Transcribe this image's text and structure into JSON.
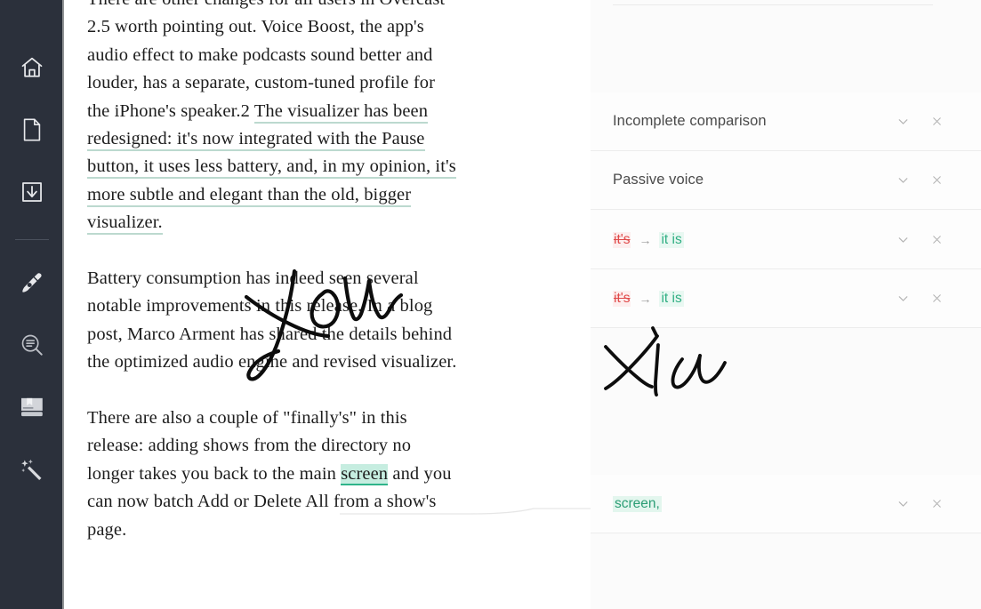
{
  "sidebar": {
    "items": [
      {
        "name": "home",
        "icon": "home-icon"
      },
      {
        "name": "document",
        "icon": "document-icon"
      },
      {
        "name": "import",
        "icon": "import-download-icon"
      },
      {
        "name": "write",
        "icon": "pen-nib-icon"
      },
      {
        "name": "plagiarism",
        "icon": "magnifier-text-icon"
      },
      {
        "name": "dictionary",
        "icon": "book-bookmark-icon"
      },
      {
        "name": "assistant",
        "icon": "magic-wand-icon"
      }
    ]
  },
  "document": {
    "paragraphs": [
      {
        "id": "p1",
        "plain_before": "There are other changes for all users in Overcast 2.5 worth pointing out. Voice Boost, the app's audio effect to make podcasts sound better and louder, has a separate, custom-tuned profile for the iPhone's speaker.2 ",
        "underlined": "The visualizer has been redesigned: it's now integrated with the Pause button, it uses less battery, and, in my opinion, it's more subtle and elegant than the old, bigger visualizer."
      },
      {
        "id": "p2",
        "text": "Battery consumption has indeed seen several notable improvements in this release. In a blog post, Marco Arment has shared the details behind the optimized audio engine and revised visualizer."
      },
      {
        "id": "p3",
        "before": "There are also a couple of \"finally's\" in this release: adding shows from the directory no longer takes you back to the main ",
        "highlight": "screen",
        "after": " and you can now batch Add or Delete All from a show's page."
      }
    ]
  },
  "suggestions": {
    "cards": [
      {
        "type": "label",
        "label": "Incomplete comparison",
        "expand_icon": "chevron-down-icon",
        "dismiss_icon": "close-icon"
      },
      {
        "type": "label",
        "label": "Passive voice",
        "expand_icon": "chevron-down-icon",
        "dismiss_icon": "close-icon"
      },
      {
        "type": "replace",
        "old": "it's",
        "arrow": "→",
        "new": "it is",
        "expand_icon": "chevron-down-icon",
        "dismiss_icon": "close-icon"
      },
      {
        "type": "replace",
        "old": "it's",
        "arrow": "→",
        "new": "it is",
        "expand_icon": "chevron-down-icon",
        "dismiss_icon": "close-icon"
      },
      {
        "type": "insert",
        "insert": "screen,",
        "expand_icon": "chevron-down-icon",
        "dismiss_icon": "close-icon"
      }
    ]
  },
  "colors": {
    "sidebar_bg": "#2b303b",
    "suggestion_underline": "#bcd9cf",
    "highlight_bg": "#c6ede0",
    "highlight_underline": "#2fb48a",
    "error_red": "#e04a4a",
    "suggest_green": "#2fae82",
    "panel_bg": "#fbfbfb",
    "icon_gray": "#b4b4b4"
  },
  "annotations": {
    "ink_strokes": "handwritten-ink-overlay"
  }
}
